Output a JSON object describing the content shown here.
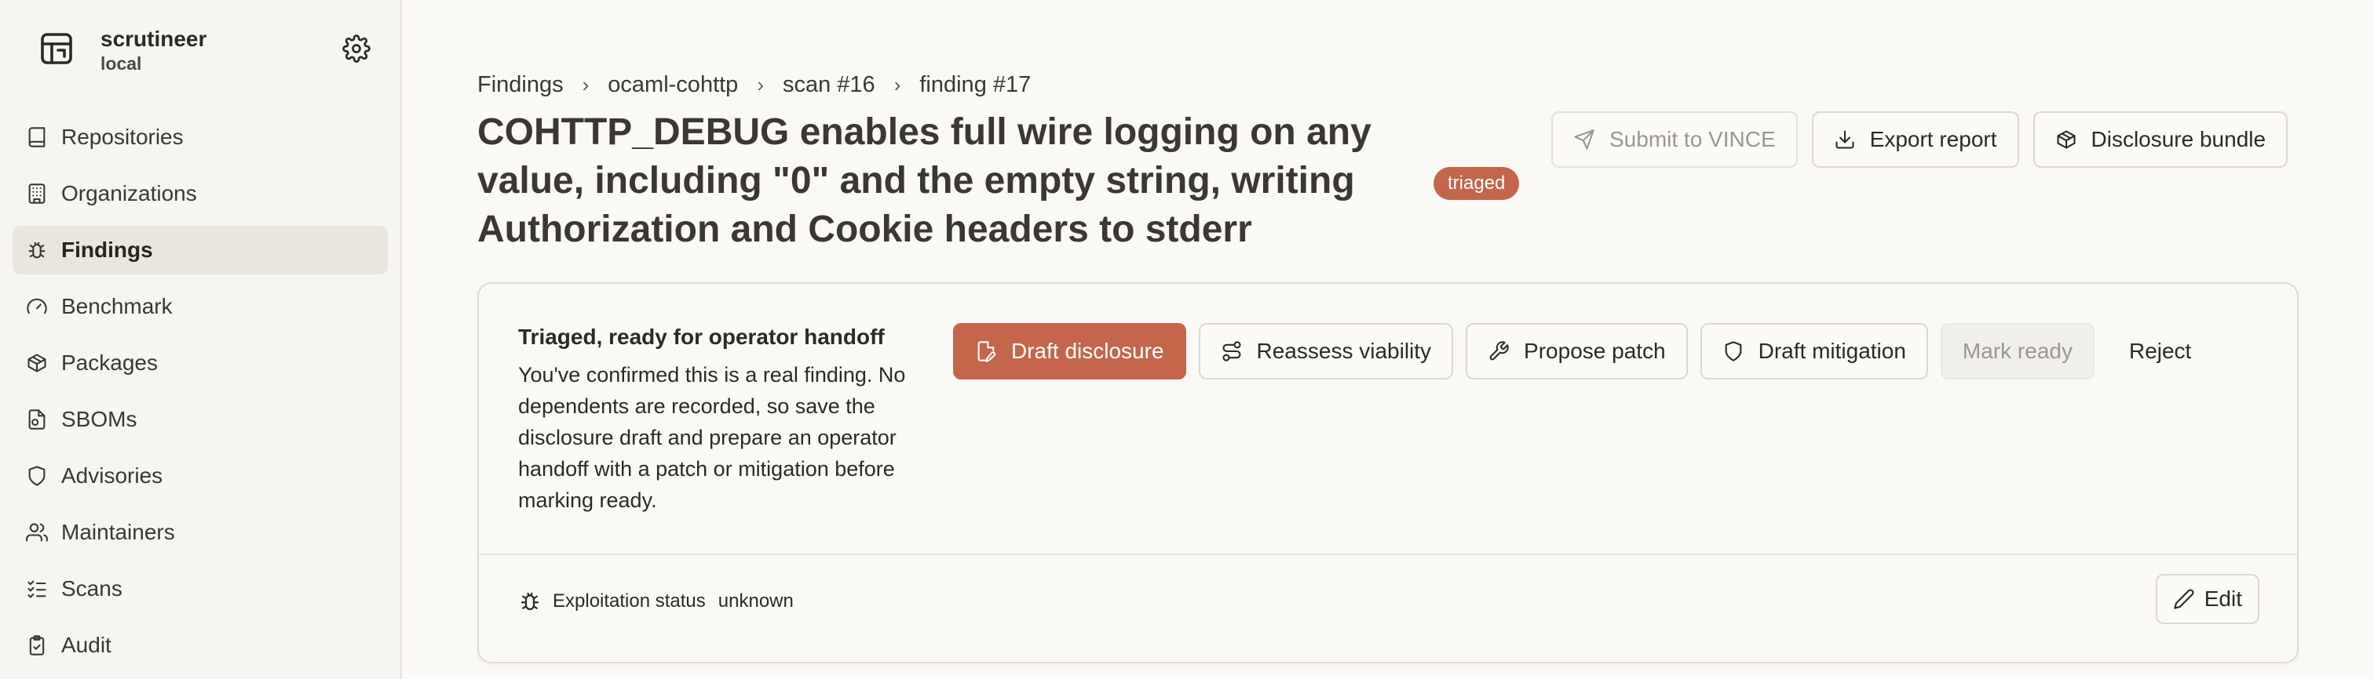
{
  "app": {
    "name": "scrutineer",
    "env": "local"
  },
  "sidebar": {
    "items": [
      {
        "label": "Repositories",
        "icon": "repository-icon",
        "active": false
      },
      {
        "label": "Organizations",
        "icon": "building-icon",
        "active": false
      },
      {
        "label": "Findings",
        "icon": "bug-icon",
        "active": true
      },
      {
        "label": "Benchmark",
        "icon": "gauge-icon",
        "active": false
      },
      {
        "label": "Packages",
        "icon": "package-icon",
        "active": false
      },
      {
        "label": "SBOMs",
        "icon": "sbom-file-icon",
        "active": false
      },
      {
        "label": "Advisories",
        "icon": "shield-icon",
        "active": false
      },
      {
        "label": "Maintainers",
        "icon": "users-icon",
        "active": false
      },
      {
        "label": "Scans",
        "icon": "checklist-icon",
        "active": false
      },
      {
        "label": "Audit",
        "icon": "clipboard-check-icon",
        "active": false
      }
    ]
  },
  "breadcrumb": [
    "Findings",
    "ocaml-cohttp",
    "scan #16",
    "finding #17"
  ],
  "finding": {
    "title": "COHTTP_DEBUG enables full wire logging on any value, including \"0\" and the empty string, writing Authorization and Cookie headers to stderr",
    "status_badge": "triaged"
  },
  "top_actions": {
    "submit": "Submit to VINCE",
    "export": "Export report",
    "bundle": "Disclosure bundle"
  },
  "handoff": {
    "title": "Triaged, ready for operator handoff",
    "description": "You've confirmed this is a real finding. No dependents are recorded, so save the disclosure draft and prepare an operator handoff with a patch or mitigation before marking ready.",
    "actions": {
      "draft_disclosure": "Draft disclosure",
      "reassess": "Reassess viability",
      "propose_patch": "Propose patch",
      "draft_mitigation": "Draft mitigation",
      "mark_ready": "Mark ready",
      "reject": "Reject"
    }
  },
  "exploitation": {
    "label": "Exploitation status",
    "value": "unknown",
    "edit": "Edit"
  },
  "colors": {
    "accent": "#c4664a",
    "background": "#faf9f6",
    "sidebar": "#f6f5f1"
  }
}
